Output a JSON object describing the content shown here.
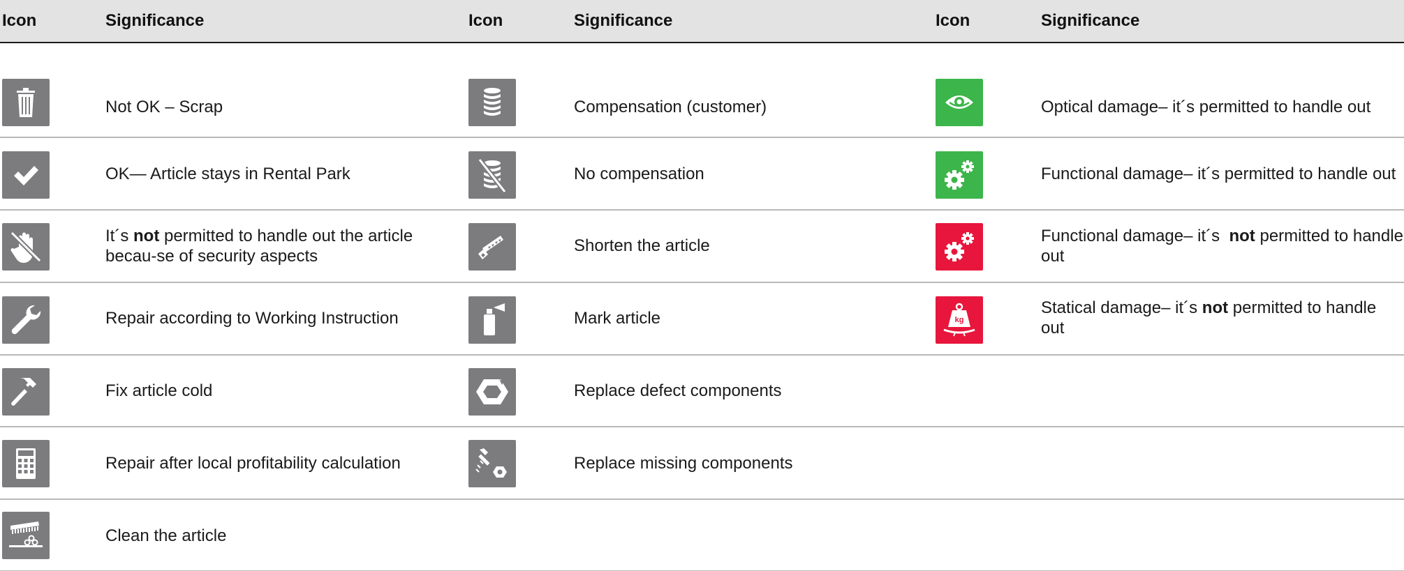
{
  "header": {
    "col1_icon": "Icon",
    "col1_sig": "Significance",
    "col2_icon": "Icon",
    "col2_sig": "Significance",
    "col3_icon": "Icon",
    "col3_sig": "Significance"
  },
  "colors": {
    "header_bg": "#e3e3e3",
    "icon_gray": "#7c7c7f",
    "icon_green": "#3cb54a",
    "icon_red": "#e8163c",
    "row_divider": "#b9b9b9"
  },
  "col1": [
    {
      "icon": "trash-icon",
      "text": "Not OK – Scrap"
    },
    {
      "icon": "checkmark-icon",
      "text": "OK— Article stays in Rental Park"
    },
    {
      "icon": "no-hand-icon",
      "text_a": "It´s ",
      "text_bold": "not",
      "text_b": " permitted to handle out the article becau-se of security aspects"
    },
    {
      "icon": "wrench-icon",
      "text": "Repair according to Working Instruction"
    },
    {
      "icon": "hammer-icon",
      "text": "Fix article cold"
    },
    {
      "icon": "calculator-icon",
      "text": "Repair after local profitability calculation"
    },
    {
      "icon": "cleaning-brush-icon",
      "text": "Clean the article"
    }
  ],
  "col2": [
    {
      "icon": "coin-stack-icon",
      "text": "Compensation (customer)"
    },
    {
      "icon": "no-coins-icon",
      "text": "No compensation"
    },
    {
      "icon": "saw-icon",
      "text": "Shorten the article"
    },
    {
      "icon": "spray-can-icon",
      "text": "Mark article"
    },
    {
      "icon": "damaged-nut-icon",
      "text": "Replace defect components"
    },
    {
      "icon": "bolt-nut-icon",
      "text": "Replace missing components"
    }
  ],
  "col3": [
    {
      "icon": "eye-icon",
      "color": "green",
      "text": "Optical damage– it´s permitted to handle out"
    },
    {
      "icon": "gears-icon",
      "color": "green",
      "text": "Functional damage– it´s permitted to handle out"
    },
    {
      "icon": "gears-icon",
      "color": "red",
      "text_a": "Functional damage– it´s  ",
      "text_bold": "not",
      "text_b": " permitted to handle out"
    },
    {
      "icon": "weight-kg-icon",
      "color": "red",
      "text_a": "Statical damage– it´s ",
      "text_bold": "not",
      "text_b": " permitted to handle out",
      "weight_label": "kg"
    }
  ]
}
